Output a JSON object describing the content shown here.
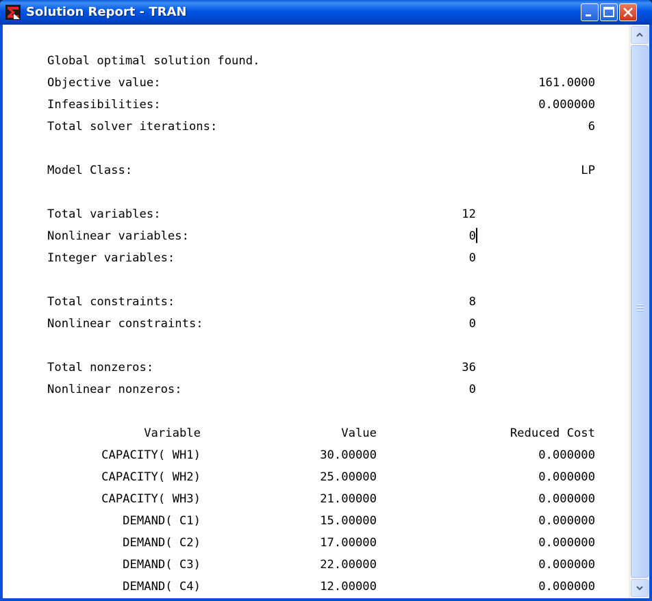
{
  "window": {
    "title": "Solution Report - TRAN",
    "icon": "lingo-sigma-icon",
    "buttons": [
      "minimize",
      "maximize",
      "close"
    ]
  },
  "report": {
    "status": "Global optimal solution found.",
    "objective_label": "Objective value:",
    "objective_value": "161.0000",
    "infeasibilities_label": "Infeasibilities:",
    "infeasibilities_value": "0.000000",
    "iterations_label": "Total solver iterations:",
    "iterations_value": "6",
    "model_class_label": "Model Class:",
    "model_class_value": "LP",
    "total_variables_label": "Total variables:",
    "total_variables_value": "12",
    "nonlinear_variables_label": "Nonlinear variables:",
    "nonlinear_variables_value": "0",
    "integer_variables_label": "Integer variables:",
    "integer_variables_value": "0",
    "total_constraints_label": "Total constraints:",
    "total_constraints_value": "8",
    "nonlinear_constraints_label": "Nonlinear constraints:",
    "nonlinear_constraints_value": "0",
    "total_nonzeros_label": "Total nonzeros:",
    "total_nonzeros_value": "36",
    "nonlinear_nonzeros_label": "Nonlinear nonzeros:",
    "nonlinear_nonzeros_value": "0",
    "columns": [
      "Variable",
      "Value",
      "Reduced Cost"
    ],
    "rows": [
      [
        "CAPACITY( WH1)",
        "30.00000",
        "0.000000"
      ],
      [
        "CAPACITY( WH2)",
        "25.00000",
        "0.000000"
      ],
      [
        "CAPACITY( WH3)",
        "21.00000",
        "0.000000"
      ],
      [
        "DEMAND( C1)",
        "15.00000",
        "0.000000"
      ],
      [
        "DEMAND( C2)",
        "17.00000",
        "0.000000"
      ],
      [
        "DEMAND( C3)",
        "22.00000",
        "0.000000"
      ],
      [
        "DEMAND( C4)",
        "12.00000",
        "0.000000"
      ]
    ]
  },
  "colors": {
    "titlebar": "#0055e5",
    "close_button": "#c9381b",
    "text": "#000000",
    "background": "#ffffff"
  }
}
